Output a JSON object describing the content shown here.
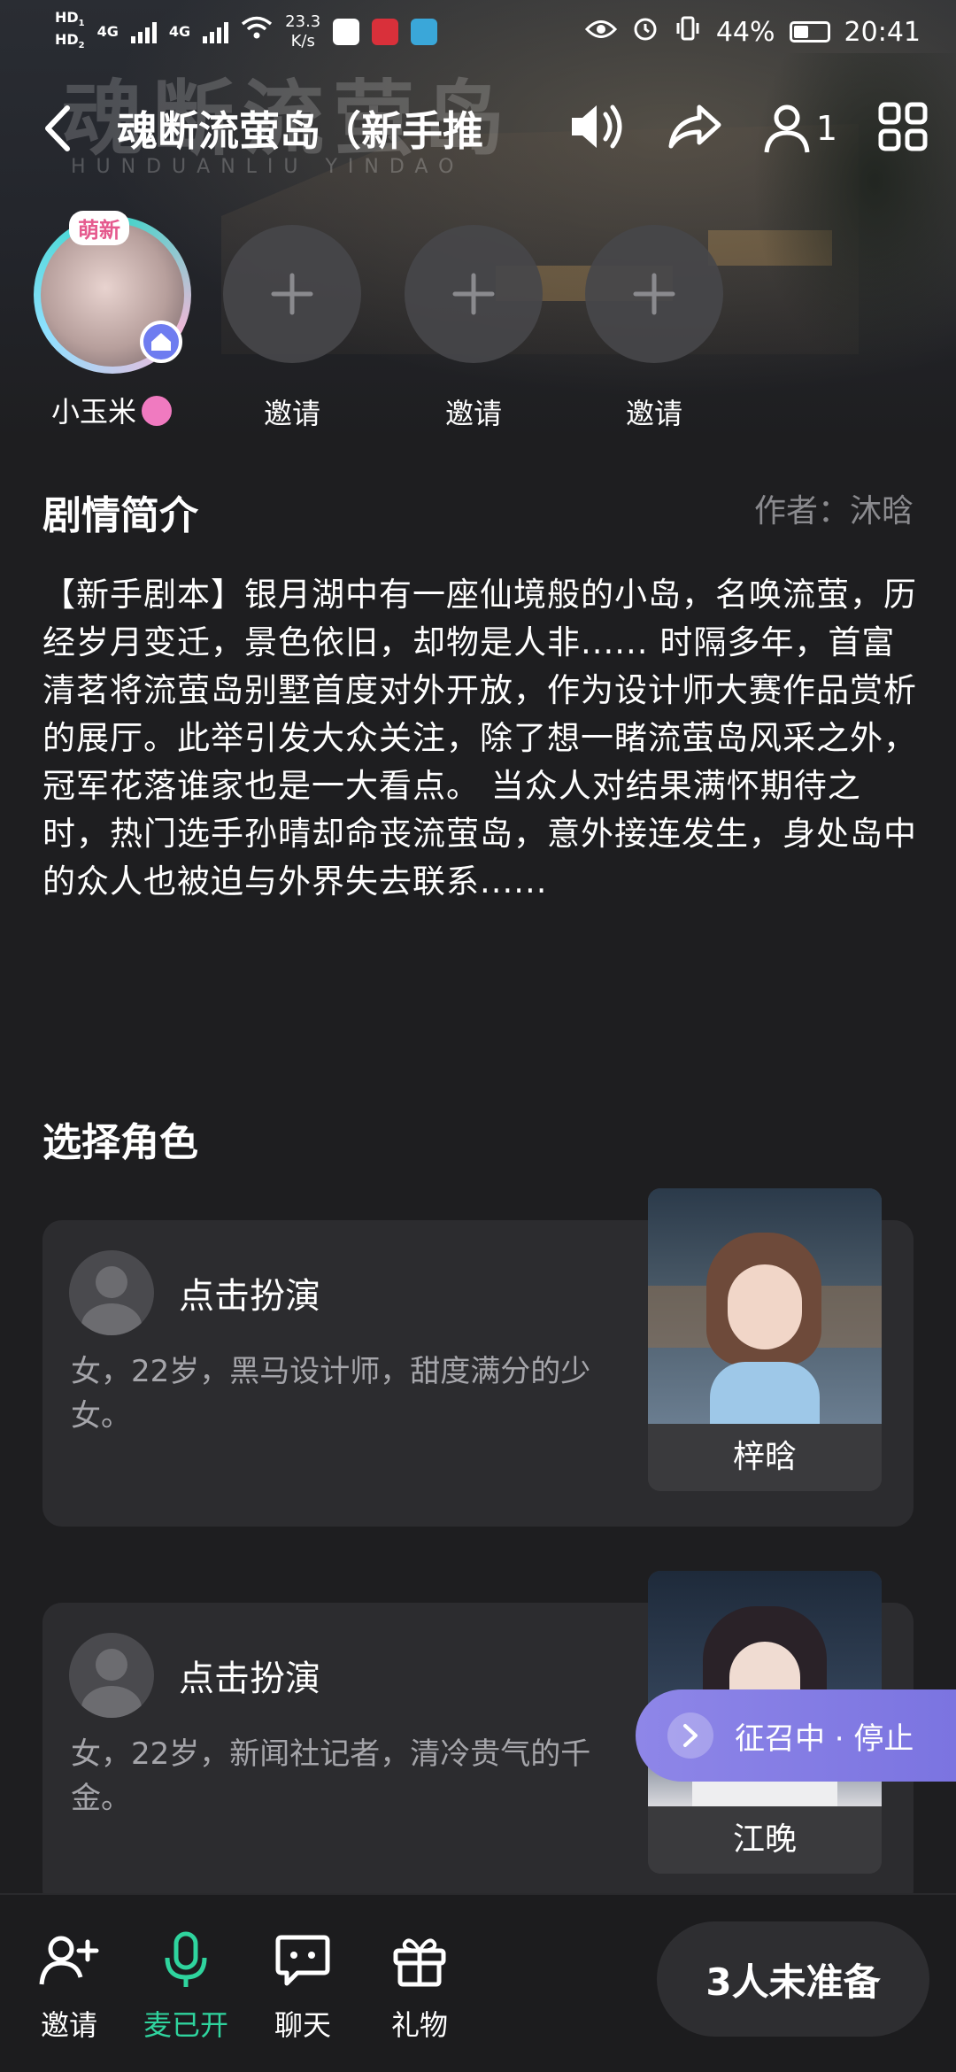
{
  "status_bar": {
    "hd1": "HD",
    "hd1_sub": "1",
    "hd2": "HD",
    "hd2_sub": "2",
    "net1": "4G",
    "net2": "4G",
    "speed_value": "23.3",
    "speed_unit": "K/s",
    "battery": "44%",
    "time": "20:41"
  },
  "hero": {
    "bg_title": "魂断流萤岛",
    "bg_subtitle": "HUNDUANLIU YINDAO"
  },
  "titlebar": {
    "title": "魂断流萤岛（新手推",
    "online_count": "1"
  },
  "seats": {
    "host_name": "小玉米",
    "host_tag": "萌新",
    "invite_labels": [
      "邀请",
      "邀请",
      "邀请"
    ]
  },
  "story": {
    "heading": "剧情简介",
    "author": "作者：沐晗",
    "text": "【新手剧本】银月湖中有一座仙境般的小岛，名唤流萤，历经岁月变迁，景色依旧，却物是人非...... 时隔多年，首富清茗将流萤岛别墅首度对外开放，作为设计师大赛作品赏析的展厅。此举引发大众关注，除了想一睹流萤岛风采之外，冠军花落谁家也是一大看点。 当众人对结果满怀期待之时，热门选手孙晴却命丧流萤岛，意外接连发生，身处岛中的众人也被迫与外界失去联系......"
  },
  "roles": {
    "heading": "选择角色",
    "items": [
      {
        "action": "点击扮演",
        "desc": "女，22岁，黑马设计师，甜度满分的少女。",
        "character": "梓晗"
      },
      {
        "action": "点击扮演",
        "desc": "女，22岁，新闻社记者，清冷贵气的千金。",
        "character": "江晚"
      }
    ]
  },
  "recruit": {
    "label": "征召中 · 停止"
  },
  "bottom_bar": {
    "invite": "邀请",
    "mic": "麦已开",
    "chat": "聊天",
    "gift": "礼物",
    "ready_status": "3人未准备"
  },
  "colors": {
    "accent_green": "#2fd49e",
    "recruit_purple": "#8e86e8",
    "background": "#1e1e20"
  }
}
